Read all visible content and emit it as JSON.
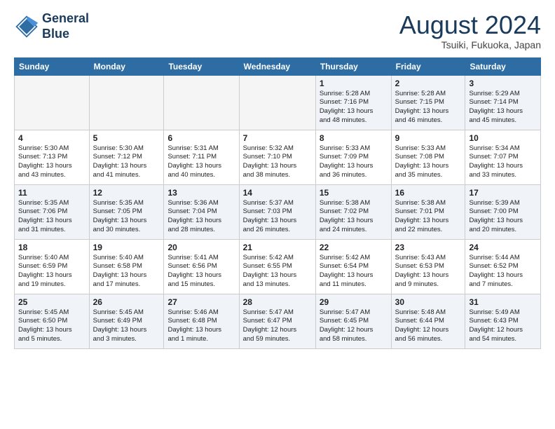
{
  "header": {
    "logo_line1": "General",
    "logo_line2": "Blue",
    "month": "August 2024",
    "location": "Tsuiki, Fukuoka, Japan"
  },
  "columns": [
    "Sunday",
    "Monday",
    "Tuesday",
    "Wednesday",
    "Thursday",
    "Friday",
    "Saturday"
  ],
  "rows": [
    [
      {
        "day": "",
        "info": "",
        "shaded": true
      },
      {
        "day": "",
        "info": "",
        "shaded": true
      },
      {
        "day": "",
        "info": "",
        "shaded": true
      },
      {
        "day": "",
        "info": "",
        "shaded": true
      },
      {
        "day": "1",
        "info": "Sunrise: 5:28 AM\nSunset: 7:16 PM\nDaylight: 13 hours\nand 48 minutes."
      },
      {
        "day": "2",
        "info": "Sunrise: 5:28 AM\nSunset: 7:15 PM\nDaylight: 13 hours\nand 46 minutes."
      },
      {
        "day": "3",
        "info": "Sunrise: 5:29 AM\nSunset: 7:14 PM\nDaylight: 13 hours\nand 45 minutes."
      }
    ],
    [
      {
        "day": "4",
        "info": "Sunrise: 5:30 AM\nSunset: 7:13 PM\nDaylight: 13 hours\nand 43 minutes."
      },
      {
        "day": "5",
        "info": "Sunrise: 5:30 AM\nSunset: 7:12 PM\nDaylight: 13 hours\nand 41 minutes."
      },
      {
        "day": "6",
        "info": "Sunrise: 5:31 AM\nSunset: 7:11 PM\nDaylight: 13 hours\nand 40 minutes."
      },
      {
        "day": "7",
        "info": "Sunrise: 5:32 AM\nSunset: 7:10 PM\nDaylight: 13 hours\nand 38 minutes."
      },
      {
        "day": "8",
        "info": "Sunrise: 5:33 AM\nSunset: 7:09 PM\nDaylight: 13 hours\nand 36 minutes."
      },
      {
        "day": "9",
        "info": "Sunrise: 5:33 AM\nSunset: 7:08 PM\nDaylight: 13 hours\nand 35 minutes."
      },
      {
        "day": "10",
        "info": "Sunrise: 5:34 AM\nSunset: 7:07 PM\nDaylight: 13 hours\nand 33 minutes."
      }
    ],
    [
      {
        "day": "11",
        "info": "Sunrise: 5:35 AM\nSunset: 7:06 PM\nDaylight: 13 hours\nand 31 minutes."
      },
      {
        "day": "12",
        "info": "Sunrise: 5:35 AM\nSunset: 7:05 PM\nDaylight: 13 hours\nand 30 minutes."
      },
      {
        "day": "13",
        "info": "Sunrise: 5:36 AM\nSunset: 7:04 PM\nDaylight: 13 hours\nand 28 minutes."
      },
      {
        "day": "14",
        "info": "Sunrise: 5:37 AM\nSunset: 7:03 PM\nDaylight: 13 hours\nand 26 minutes."
      },
      {
        "day": "15",
        "info": "Sunrise: 5:38 AM\nSunset: 7:02 PM\nDaylight: 13 hours\nand 24 minutes."
      },
      {
        "day": "16",
        "info": "Sunrise: 5:38 AM\nSunset: 7:01 PM\nDaylight: 13 hours\nand 22 minutes."
      },
      {
        "day": "17",
        "info": "Sunrise: 5:39 AM\nSunset: 7:00 PM\nDaylight: 13 hours\nand 20 minutes."
      }
    ],
    [
      {
        "day": "18",
        "info": "Sunrise: 5:40 AM\nSunset: 6:59 PM\nDaylight: 13 hours\nand 19 minutes."
      },
      {
        "day": "19",
        "info": "Sunrise: 5:40 AM\nSunset: 6:58 PM\nDaylight: 13 hours\nand 17 minutes."
      },
      {
        "day": "20",
        "info": "Sunrise: 5:41 AM\nSunset: 6:56 PM\nDaylight: 13 hours\nand 15 minutes."
      },
      {
        "day": "21",
        "info": "Sunrise: 5:42 AM\nSunset: 6:55 PM\nDaylight: 13 hours\nand 13 minutes."
      },
      {
        "day": "22",
        "info": "Sunrise: 5:42 AM\nSunset: 6:54 PM\nDaylight: 13 hours\nand 11 minutes."
      },
      {
        "day": "23",
        "info": "Sunrise: 5:43 AM\nSunset: 6:53 PM\nDaylight: 13 hours\nand 9 minutes."
      },
      {
        "day": "24",
        "info": "Sunrise: 5:44 AM\nSunset: 6:52 PM\nDaylight: 13 hours\nand 7 minutes."
      }
    ],
    [
      {
        "day": "25",
        "info": "Sunrise: 5:45 AM\nSunset: 6:50 PM\nDaylight: 13 hours\nand 5 minutes."
      },
      {
        "day": "26",
        "info": "Sunrise: 5:45 AM\nSunset: 6:49 PM\nDaylight: 13 hours\nand 3 minutes."
      },
      {
        "day": "27",
        "info": "Sunrise: 5:46 AM\nSunset: 6:48 PM\nDaylight: 13 hours\nand 1 minute."
      },
      {
        "day": "28",
        "info": "Sunrise: 5:47 AM\nSunset: 6:47 PM\nDaylight: 12 hours\nand 59 minutes."
      },
      {
        "day": "29",
        "info": "Sunrise: 5:47 AM\nSunset: 6:45 PM\nDaylight: 12 hours\nand 58 minutes."
      },
      {
        "day": "30",
        "info": "Sunrise: 5:48 AM\nSunset: 6:44 PM\nDaylight: 12 hours\nand 56 minutes."
      },
      {
        "day": "31",
        "info": "Sunrise: 5:49 AM\nSunset: 6:43 PM\nDaylight: 12 hours\nand 54 minutes."
      }
    ]
  ]
}
